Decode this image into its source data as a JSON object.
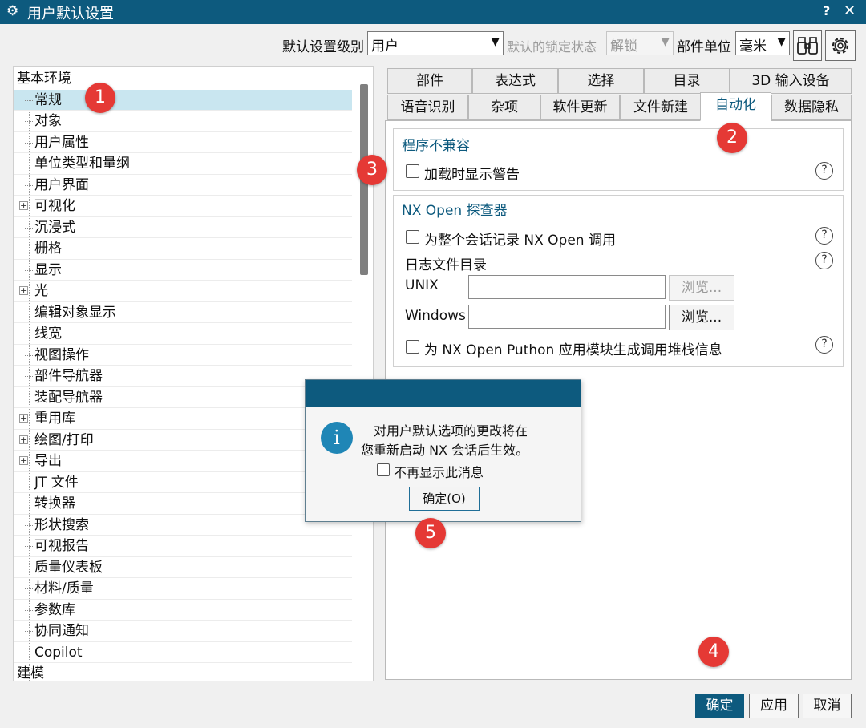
{
  "window": {
    "title": "用户默认设置",
    "help": "?",
    "close": "✕"
  },
  "toolbar": {
    "level_label": "默认设置级别",
    "level_value": "用户",
    "lock_label": "默认的锁定状态",
    "lock_value": "解锁",
    "units_label": "部件单位",
    "units_value": "毫米"
  },
  "tree": {
    "root": "基本环境",
    "items": [
      {
        "label": "常规",
        "expandable": false,
        "selected": true
      },
      {
        "label": "对象",
        "expandable": false
      },
      {
        "label": "用户属性",
        "expandable": false
      },
      {
        "label": "单位类型和量纲",
        "expandable": false
      },
      {
        "label": "用户界面",
        "expandable": false
      },
      {
        "label": "可视化",
        "expandable": true
      },
      {
        "label": "沉浸式",
        "expandable": false
      },
      {
        "label": "栅格",
        "expandable": false
      },
      {
        "label": "显示",
        "expandable": false
      },
      {
        "label": "光",
        "expandable": true
      },
      {
        "label": "编辑对象显示",
        "expandable": false
      },
      {
        "label": "线宽",
        "expandable": false
      },
      {
        "label": "视图操作",
        "expandable": false
      },
      {
        "label": "部件导航器",
        "expandable": false
      },
      {
        "label": "装配导航器",
        "expandable": false
      },
      {
        "label": "重用库",
        "expandable": true
      },
      {
        "label": "绘图/打印",
        "expandable": true
      },
      {
        "label": "导出",
        "expandable": true
      },
      {
        "label": "JT 文件",
        "expandable": false
      },
      {
        "label": "转换器",
        "expandable": false
      },
      {
        "label": "形状搜索",
        "expandable": false
      },
      {
        "label": "可视报告",
        "expandable": false
      },
      {
        "label": "质量仪表板",
        "expandable": false
      },
      {
        "label": "材料/质量",
        "expandable": false
      },
      {
        "label": "参数库",
        "expandable": false
      },
      {
        "label": "协同通知",
        "expandable": false
      },
      {
        "label": "Copilot",
        "expandable": false
      }
    ],
    "next_root": "建模"
  },
  "tabs": {
    "row1": [
      "部件",
      "表达式",
      "选择",
      "目录",
      "3D 输入设备"
    ],
    "row2": [
      "语音识别",
      "杂项",
      "软件更新",
      "文件新建",
      "自动化",
      "数据隐私"
    ],
    "active": "自动化"
  },
  "compat": {
    "title": "程序不兼容",
    "warn_on_load": "加载时显示警告"
  },
  "nxopen": {
    "title": "NX Open 探查器",
    "record_session": "为整个会话记录 NX Open 调用",
    "log_dir": "日志文件目录",
    "unix_label": "UNIX",
    "unix_value": "",
    "windows_label": "Windows",
    "windows_value": "",
    "browse": "浏览...",
    "python_stack": "为 NX Open Puthon 应用模块生成调用堆栈信息"
  },
  "dialog": {
    "line1": "对用户默认选项的更改将在",
    "line2": "您重新启动 NX 会话后生效。",
    "dont_show": "不再显示此消息",
    "ok": "确定(O)"
  },
  "footer": {
    "ok": "确定",
    "apply": "应用",
    "cancel": "取消"
  },
  "markers": [
    "1",
    "2",
    "3",
    "4",
    "5"
  ],
  "colors": {
    "titlebar": "#0d5a7e",
    "selection": "#c9e6f0",
    "marker": "#e53935",
    "info_icon": "#1f86b6"
  },
  "icons": {
    "window": "gear-icon",
    "find": "binoculars-icon",
    "settings": "gear-icon",
    "info": "info-icon",
    "help": "question-icon"
  }
}
